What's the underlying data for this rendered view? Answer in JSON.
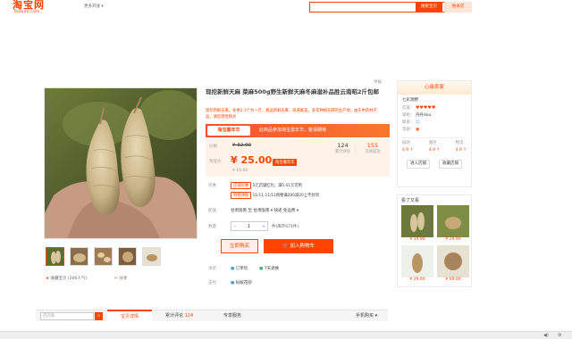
{
  "header": {
    "logo_main": "淘宝网",
    "logo_sub": "Taobao.com",
    "region": "更多开放 ▾",
    "search_btn": "搜索宝贝",
    "search_shop": "搜本店"
  },
  "product": {
    "title": "现挖新鲜天麻 菜麻500g野生新鲜天麻冬麻滋补品胜云南昭2斤包邮",
    "subtitle": "现挖新鲜天麻，冬季2-3个为一斤，真品新鲜天麻，味道鲜美，多年种植天麻的主产地，由于中药材产品，请您理性购买",
    "report": "举报",
    "banner_logo": "淘宝嘉年华",
    "banner_text": "此商品参加淘宝嘉年华，敬请期待",
    "price_label": "价格",
    "orig_price": "¥ 32.00",
    "promo_label": "淘宝价",
    "promo_price": "¥ 25.00",
    "promo_tag": "淘宝嘉年华",
    "promo_note": "¥ 19.00",
    "sales_count": "124",
    "sales_label": "累计评论",
    "trade_count": "155",
    "trade_label": "交易成功",
    "benefit_label": "优惠",
    "benefit_tag1": "店铺优惠",
    "benefit_text1": "5元店铺红包；满5.01元可用",
    "benefit_tag2": "购物津贴",
    "benefit_text2": "11/11-11/11购物满200减20上不封顶",
    "delivery_label": "配送",
    "delivery_text": "甘肃陇南 至 甘肃陇南 ▾   快递 免运费 ▾",
    "qty_label": "数量",
    "qty_value": "1",
    "stock_text": "件(库存671件)",
    "buy_btn": "立即购买",
    "cart_btn": "加入购物车",
    "promise_label": "承诺",
    "promise1": "订单险",
    "promise2": "7天退换",
    "payment_label": "支付",
    "payment1": "蚂蚁花呗",
    "fav": "收藏宝贝",
    "fav_count": "(266人气)",
    "share": "分享"
  },
  "seller": {
    "head": "心级卖家",
    "name": "七彩源野",
    "level_label": "信誉：",
    "contact_label": "掌柜：",
    "contact": "丹丹dou",
    "service_label": "联系：",
    "qual_label": "资质：",
    "score_titles": [
      "描述",
      "服务",
      "物流"
    ],
    "scores": [
      "4.9 ↑",
      "4.9 ↑",
      "4.9 ↑"
    ],
    "enter_shop": "进入店铺",
    "fav_shop": "收藏店铺"
  },
  "seen": {
    "head": "看了又看",
    "prices": [
      "¥ 19.90",
      "¥ 29.90",
      "¥ 29.90",
      "¥ 69.00"
    ]
  },
  "tabs": {
    "search_placeholder": "店内搜",
    "detail": "宝贝详情",
    "reviews": "累计评论",
    "reviews_count": "124",
    "service": "专享服务",
    "phone_buy": "手机购买 ▾"
  },
  "colors": {
    "accent": "#ff4400",
    "price_bg": "#fff2e8"
  }
}
